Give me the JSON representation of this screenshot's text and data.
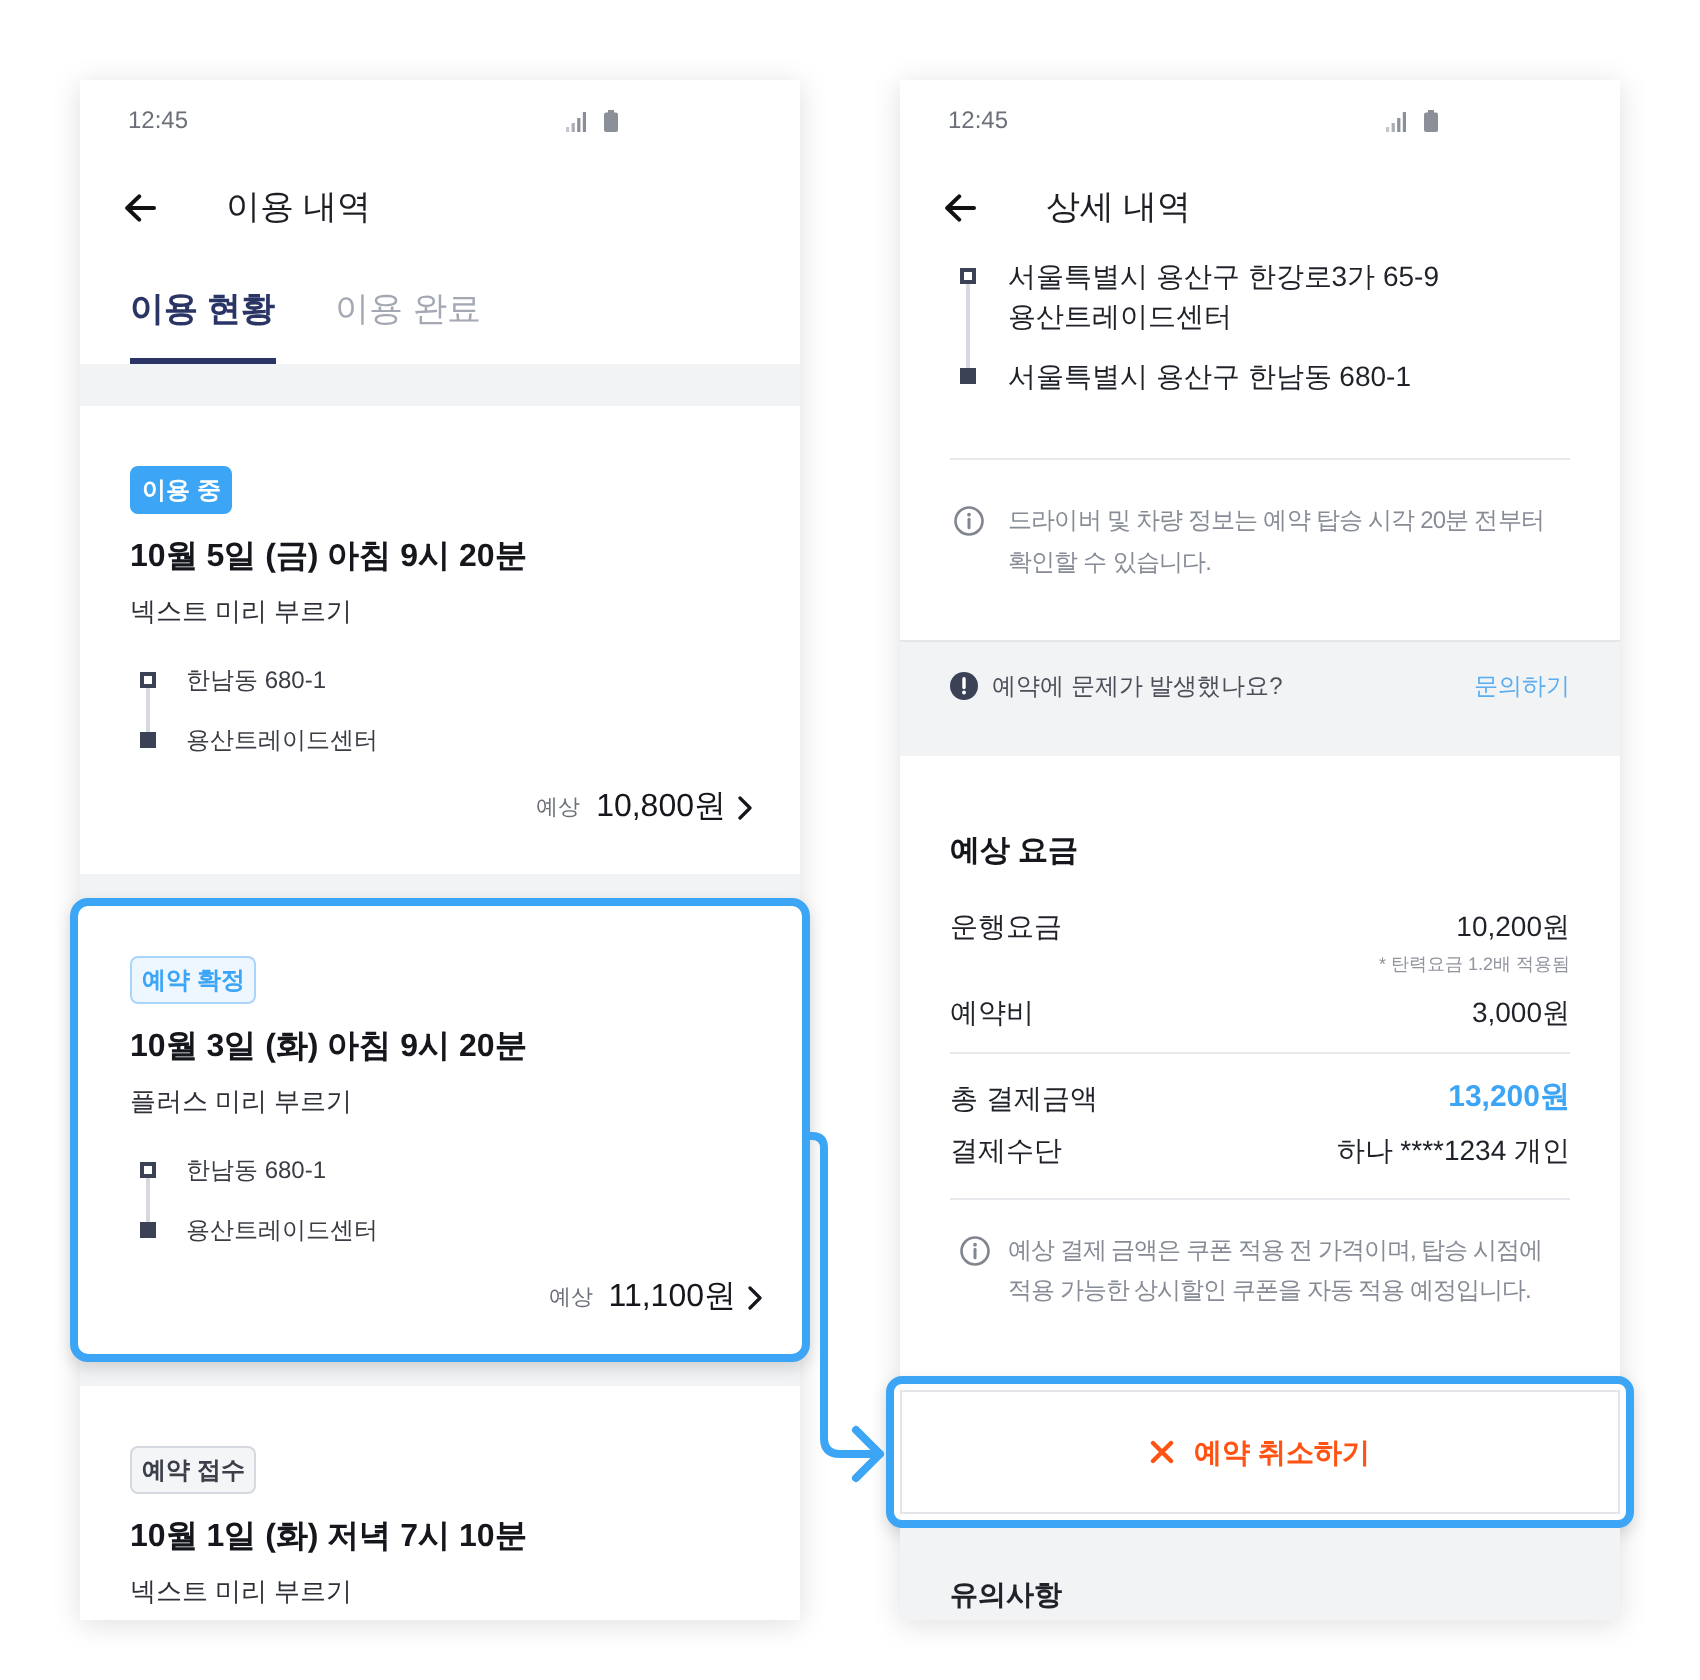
{
  "list_screen": {
    "status_bar": {
      "time": "12:45"
    },
    "header": {
      "title": "이용 내역"
    },
    "tabs": [
      {
        "label": "이용 현황",
        "selected": true
      },
      {
        "label": "이용 완료",
        "selected": false
      }
    ],
    "bookings": [
      {
        "badge": {
          "text": "이용 중",
          "kind": "filled"
        },
        "title": "10월 5일 (금) 아침 9시 20분",
        "service": "넥스트 미리 부르기",
        "stops": [
          {
            "kind": "start",
            "address": "한남동 680-1"
          },
          {
            "kind": "end",
            "address": "용산트레이드센터"
          }
        ],
        "price_label": "예상",
        "price": "10,800원",
        "highlighted": false
      },
      {
        "badge": {
          "text": "예약 확정",
          "kind": "outline"
        },
        "title": "10월 3일 (화) 아침 9시 20분",
        "service": "플러스 미리 부르기",
        "stops": [
          {
            "kind": "start",
            "address": "한남동 680-1"
          },
          {
            "kind": "end",
            "address": "용산트레이드센터"
          }
        ],
        "price_label": "예상",
        "price": "11,100원",
        "highlighted": true
      },
      {
        "badge": {
          "text": "예약 접수",
          "kind": "neutral"
        },
        "title": "10월 1일 (화) 저녁 7시 10분",
        "service": "넥스트 미리 부르기",
        "highlighted": false
      }
    ]
  },
  "detail_screen": {
    "status_bar": {
      "time": "12:45"
    },
    "header": {
      "title": "상세 내역"
    },
    "stops": [
      {
        "kind": "start",
        "address": "서울특별시 용산구 한강로3가 65-9\n용산트레이드센터"
      },
      {
        "kind": "end",
        "address": "서울특별시 용산구 한남동 680-1"
      }
    ],
    "driver_notice": "드라이버 및 차량 정보는 예약 탑승 시각 20분 전부터 확인할 수 있습니다.",
    "help": {
      "question": "예약에 문제가 발생했나요?",
      "link": "문의하기"
    },
    "fare": {
      "title": "예상 요금",
      "groups": [
        {
          "rows": [
            {
              "label": "운행요금",
              "value": "10,200원",
              "note": "* 탄력요금 1.2배 적용됨",
              "emphasized": false
            },
            {
              "label": "예약비",
              "value": "3,000원",
              "emphasized": false
            }
          ]
        },
        {
          "rows": [
            {
              "label": "총 결제금액",
              "value": "13,200원",
              "emphasized": true
            },
            {
              "label": "결제수단",
              "value": "하나 ****1234 개인",
              "emphasized": false
            }
          ]
        }
      ],
      "notice": "예상 결제 금액은 쿠폰 적용 전 가격이며, 탑승 시점에 적용 가능한 상시할인 쿠폰을 자동 적용 예정입니다."
    },
    "cancel_button": {
      "label": "예약 취소하기",
      "highlighted": true
    },
    "precautions": {
      "title": "유의사항"
    }
  }
}
